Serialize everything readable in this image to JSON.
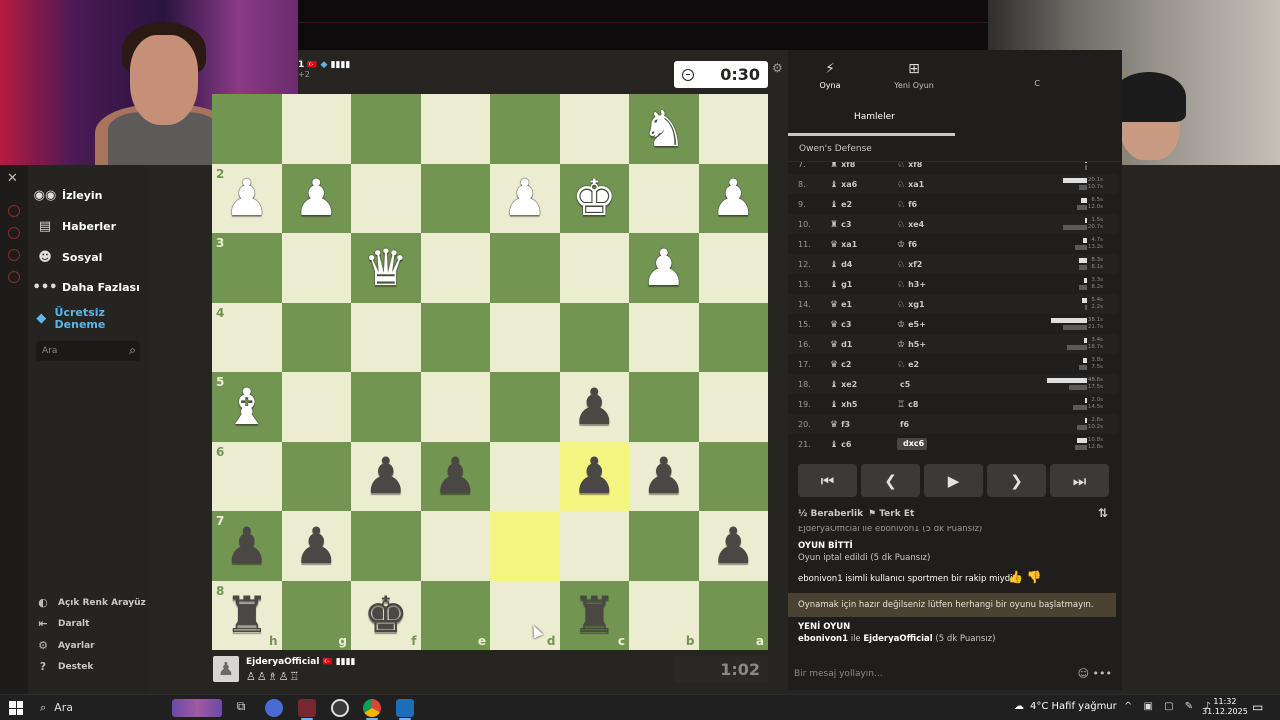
{
  "top_player": {
    "name_fragment": "1",
    "flag": "🇹🇷",
    "rating_fragment": "+2"
  },
  "clocks": {
    "top": "0:30",
    "bottom": "1:02"
  },
  "bottom_player": {
    "name": "EjderyaOfficial",
    "flag": "🇹🇷",
    "captured": "♙♙♗♙♖"
  },
  "sidebar": {
    "items": [
      {
        "label": "İzleyin",
        "icon": "binoculars-icon"
      },
      {
        "label": "Haberler",
        "icon": "news-icon"
      },
      {
        "label": "Sosyal",
        "icon": "people-icon"
      },
      {
        "label": "Daha Fazlası",
        "icon": "more-dots-icon"
      },
      {
        "label": "Ücretsiz Deneme",
        "icon": "diamond-icon"
      }
    ],
    "search_placeholder": "Ara",
    "footer": [
      {
        "label": "Açık Renk Arayüz",
        "icon": "contrast-icon"
      },
      {
        "label": "Daralt",
        "icon": "collapse-icon"
      },
      {
        "label": "Ayarlar",
        "icon": "gear-icon"
      },
      {
        "label": "Destek",
        "icon": "help-icon"
      }
    ]
  },
  "board": {
    "ranks": [
      "2",
      "3",
      "4",
      "5",
      "6",
      "7",
      "8"
    ],
    "files": [
      "h",
      "g",
      "f",
      "e",
      "d",
      "c",
      "b",
      "a"
    ],
    "rows": [
      [
        "",
        "",
        "",
        "",
        "",
        "",
        "wN",
        ""
      ],
      [
        "wP",
        "wP",
        "",
        "",
        "wP",
        "wK",
        "",
        "wP"
      ],
      [
        "",
        "",
        "wQ",
        "",
        "",
        "",
        "wP",
        ""
      ],
      [
        "",
        "",
        "",
        "",
        "",
        "",
        "",
        ""
      ],
      [
        "wB",
        "",
        "",
        "",
        "",
        "bP",
        "",
        ""
      ],
      [
        "",
        "",
        "bP",
        "bP",
        "",
        "bP",
        "bP",
        ""
      ],
      [
        "bP",
        "bP",
        "",
        "",
        "",
        "",
        "",
        "bP"
      ],
      [
        "bR",
        "",
        "bK",
        "",
        "",
        "bR",
        "",
        ""
      ]
    ],
    "highlights": [
      [
        5,
        5
      ],
      [
        6,
        4
      ]
    ]
  },
  "panel": {
    "tabs": [
      {
        "label": "Oyna",
        "icon": "bolt-icon"
      },
      {
        "label": "Yeni Oyun",
        "icon": "plus-square-icon"
      },
      {
        "label": "C",
        "icon": ""
      }
    ],
    "subtab": "Hamleler",
    "opening": "Owen's Defense",
    "moves": [
      {
        "num": "7.",
        "w": "xf8",
        "wp": "♜",
        "b": "xf8",
        "bp": "♘",
        "t1": "19.7s",
        "t2": "",
        "f1": 0,
        "f2": 0
      },
      {
        "num": "8.",
        "w": "xa6",
        "wp": "♝",
        "b": "xa1",
        "bp": "♘",
        "t1": "20.1s",
        "t2": "10.7s",
        "f1": 0.3,
        "f2": 0.1
      },
      {
        "num": "9.",
        "w": "e2",
        "wp": "♝",
        "b": "f6",
        "bp": "♘",
        "t1": "6.5s",
        "t2": "12.0s",
        "f1": 0.07,
        "f2": 0.12
      },
      {
        "num": "10.",
        "w": "c3",
        "wp": "♜",
        "b": "xe4",
        "bp": "♘",
        "t1": "1.5s",
        "t2": "20.7s",
        "f1": 0.02,
        "f2": 0.3
      },
      {
        "num": "11.",
        "w": "xa1",
        "wp": "♛",
        "b": "f6",
        "bp": "♔",
        "t1": "4.7s",
        "t2": "13.2s",
        "f1": 0.05,
        "f2": 0.15
      },
      {
        "num": "12.",
        "w": "d4",
        "wp": "♝",
        "b": "xf2",
        "bp": "♘",
        "t1": "8.3s",
        "t2": "8.1s",
        "f1": 0.1,
        "f2": 0.1
      },
      {
        "num": "13.",
        "w": "g1",
        "wp": "♝",
        "b": "h3+",
        "bp": "♘",
        "t1": "3.3s",
        "t2": "8.2s",
        "f1": 0.04,
        "f2": 0.1
      },
      {
        "num": "14.",
        "w": "e1",
        "wp": "♛",
        "b": "xg1",
        "bp": "♘",
        "t1": "5.4s",
        "t2": "2.2s",
        "f1": 0.06,
        "f2": 0.03
      },
      {
        "num": "15.",
        "w": "c3",
        "wp": "♛",
        "b": "e5+",
        "bp": "♔",
        "t1": "38.1s",
        "t2": "21.7s",
        "f1": 0.45,
        "f2": 0.3
      },
      {
        "num": "16.",
        "w": "d1",
        "wp": "♛",
        "b": "h5+",
        "bp": "♔",
        "t1": "3.4s",
        "t2": "18.7s",
        "f1": 0.04,
        "f2": 0.25
      },
      {
        "num": "17.",
        "w": "c2",
        "wp": "♛",
        "b": "e2",
        "bp": "♘",
        "t1": "3.8s",
        "t2": "7.5s",
        "f1": 0.05,
        "f2": 0.1
      },
      {
        "num": "18.",
        "w": "xe2",
        "wp": "♝",
        "b": "c5",
        "bp": "",
        "t1": "48.6s",
        "t2": "17.5s",
        "f1": 0.5,
        "f2": 0.22
      },
      {
        "num": "19.",
        "w": "xh5",
        "wp": "♝",
        "b": "c8",
        "bp": "♖",
        "t1": "2.0s",
        "t2": "14.5s",
        "f1": 0.03,
        "f2": 0.18
      },
      {
        "num": "20.",
        "w": "f3",
        "wp": "♛",
        "b": "f6",
        "bp": "",
        "t1": "2.6s",
        "t2": "10.2s",
        "f1": 0.03,
        "f2": 0.12
      },
      {
        "num": "21.",
        "w": "c6",
        "wp": "♝",
        "b": "dxc6",
        "bp": "",
        "t1": "10.8s",
        "t2": "12.8s",
        "f1": 0.12,
        "f2": 0.15
      }
    ],
    "actions": {
      "draw": "Beraberlik",
      "resign": "Terk Et"
    },
    "chat": {
      "line0": "EjderyaOfficial ile ebonivon1 (5 dk Puansız)",
      "over_title": "OYUN BİTTİ",
      "over_text": "Oyun iptal edildi (5 dk Puansız)",
      "sportsman": "ebonivon1 isimli kullanıcı sportmen bir rakip miydi?",
      "notice": "Oynamak için hazır değilseniz lütfen herhangi bir oyunu başlatmayın.",
      "new_title": "YENİ OYUN",
      "new_text_a": "ebonivon1",
      "new_text_b": " ile ",
      "new_text_c": "EjderyaOfficial",
      "new_text_d": " (5 dk Puansız)"
    },
    "chat_placeholder": "Bir mesaj yollayın..."
  },
  "taskbar": {
    "search": "Ara",
    "weather": "4°C  Hafif yağmur",
    "time": "11:32",
    "date": "31.12.2025"
  }
}
